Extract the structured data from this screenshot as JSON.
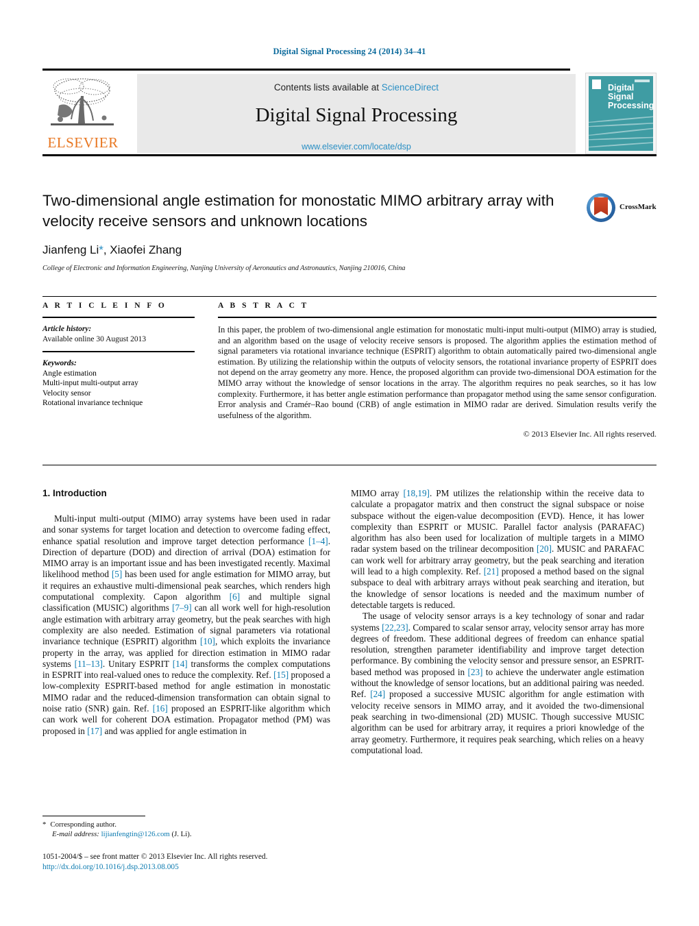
{
  "running_head": "Digital Signal Processing 24 (2014) 34–41",
  "masthead": {
    "elsevier_wordmark": "ELSEVIER",
    "contents_prefix": "Contents lists available at",
    "contents_link": "ScienceDirect",
    "journal_title": "Digital Signal Processing",
    "journal_url": "www.elsevier.com/locate/dsp",
    "cover_title_lines": [
      "Digital",
      "Signal",
      "Processing"
    ]
  },
  "article": {
    "title": "Two-dimensional angle estimation for monostatic MIMO arbitrary array with velocity receive sensors and unknown locations",
    "authors_prefix": "Jianfeng Li",
    "authors_star": "*",
    "authors_suffix": ", Xiaofei Zhang",
    "affiliation": "College of Electronic and Information Engineering, Nanjing University of Aeronautics and Astronautics, Nanjing 210016, China",
    "crossmark_label": "CrossMark"
  },
  "info": {
    "heading": "A R T I C L E    I N F O",
    "history_label": "Article history:",
    "history_value": "Available online 30 August 2013",
    "keywords_label": "Keywords:",
    "keywords": [
      "Angle estimation",
      "Multi-input multi-output array",
      "Velocity sensor",
      "Rotational invariance technique"
    ]
  },
  "abstract": {
    "heading": "A B S T R A C T",
    "text": "In this paper, the problem of two-dimensional angle estimation for monostatic multi-input multi-output (MIMO) array is studied, and an algorithm based on the usage of velocity receive sensors is proposed. The algorithm applies the estimation method of signal parameters via rotational invariance technique (ESPRIT) algorithm to obtain automatically paired two-dimensional angle estimation. By utilizing the relationship within the outputs of velocity sensors, the rotational invariance property of ESPRIT does not depend on the array geometry any more. Hence, the proposed algorithm can provide two-dimensional DOA estimation for the MIMO array without the knowledge of sensor locations in the array. The algorithm requires no peak searches, so it has low complexity. Furthermore, it has better angle estimation performance than propagator method using the same sensor configuration. Error analysis and Cramér–Rao bound (CRB) of angle estimation in MIMO radar are derived. Simulation results verify the usefulness of the algorithm.",
    "copyright": "© 2013 Elsevier Inc. All rights reserved."
  },
  "body": {
    "section_heading": "1. Introduction",
    "left_paragraphs": [
      "Multi-input multi-output (MIMO) array systems have been used in radar and sonar systems for target location and detection to overcome fading effect, enhance spatial resolution and improve target detection performance [1–4]. Direction of departure (DOD) and direction of arrival (DOA) estimation for MIMO array is an important issue and has been investigated recently. Maximal likelihood method [5] has been used for angle estimation for MIMO array, but it requires an exhaustive multi-dimensional peak searches, which renders high computational complexity. Capon algorithm [6] and multiple signal classification (MUSIC) algorithms [7–9] can all work well for high-resolution angle estimation with arbitrary array geometry, but the peak searches with high complexity are also needed. Estimation of signal parameters via rotational invariance technique (ESPRIT) algorithm [10], which exploits the invariance property in the array, was applied for direction estimation in MIMO radar systems [11–13]. Unitary ESPRIT [14] transforms the complex computations in ESPRIT into real-valued ones to reduce the complexity. Ref. [15] proposed a low-complexity ESPRIT-based method for angle estimation in monostatic MIMO radar and the reduced-dimension transformation can obtain signal to noise ratio (SNR) gain. Ref. [16] proposed an ESPRIT-like algorithm which can work well for coherent DOA estimation. Propagator method (PM) was proposed in [17] and was applied for angle estimation in"
    ],
    "right_paragraphs": [
      "MIMO array [18,19]. PM utilizes the relationship within the receive data to calculate a propagator matrix and then construct the signal subspace or noise subspace without the eigen-value decomposition (EVD). Hence, it has lower complexity than ESPRIT or MUSIC. Parallel factor analysis (PARAFAC) algorithm has also been used for localization of multiple targets in a MIMO radar system based on the trilinear decomposition [20]. MUSIC and PARAFAC can work well for arbitrary array geometry, but the peak searching and iteration will lead to a high complexity. Ref. [21] proposed a method based on the signal subspace to deal with arbitrary arrays without peak searching and iteration, but the knowledge of sensor locations is needed and the maximum number of detectable targets is reduced.",
      "The usage of velocity sensor arrays is a key technology of sonar and radar systems [22,23]. Compared to scalar sensor array, velocity sensor array has more degrees of freedom. These additional degrees of freedom can enhance spatial resolution, strengthen parameter identifiability and improve target detection performance. By combining the velocity sensor and pressure sensor, an ESPRIT-based method was proposed in [23] to achieve the underwater angle estimation without the knowledge of sensor locations, but an additional pairing was needed. Ref. [24] proposed a successive MUSIC algorithm for angle estimation with velocity receive sensors in MIMO array, and it avoided the two-dimensional peak searching in two-dimensional (2D) MUSIC. Though successive MUSIC algorithm can be used for arbitrary array, it requires a priori knowledge of the array geometry. Furthermore, it requires peak searching, which relies on a heavy computational load."
    ]
  },
  "footnote": {
    "star": "*",
    "corresponding": "Corresponding author.",
    "email_label": "E-mail address:",
    "email": "lijianfengtin@126.com",
    "email_owner": "(J. Li)."
  },
  "colophon": {
    "line1": "1051-2004/$ – see front matter © 2013 Elsevier Inc. All rights reserved.",
    "doi": "http://dx.doi.org/10.1016/j.dsp.2013.08.005"
  },
  "colors": {
    "link": "#0b7ab0",
    "sciencedirect": "#2a8fc4",
    "elsevier_orange": "#E87722",
    "cover_teal": "#3f9ca3"
  }
}
